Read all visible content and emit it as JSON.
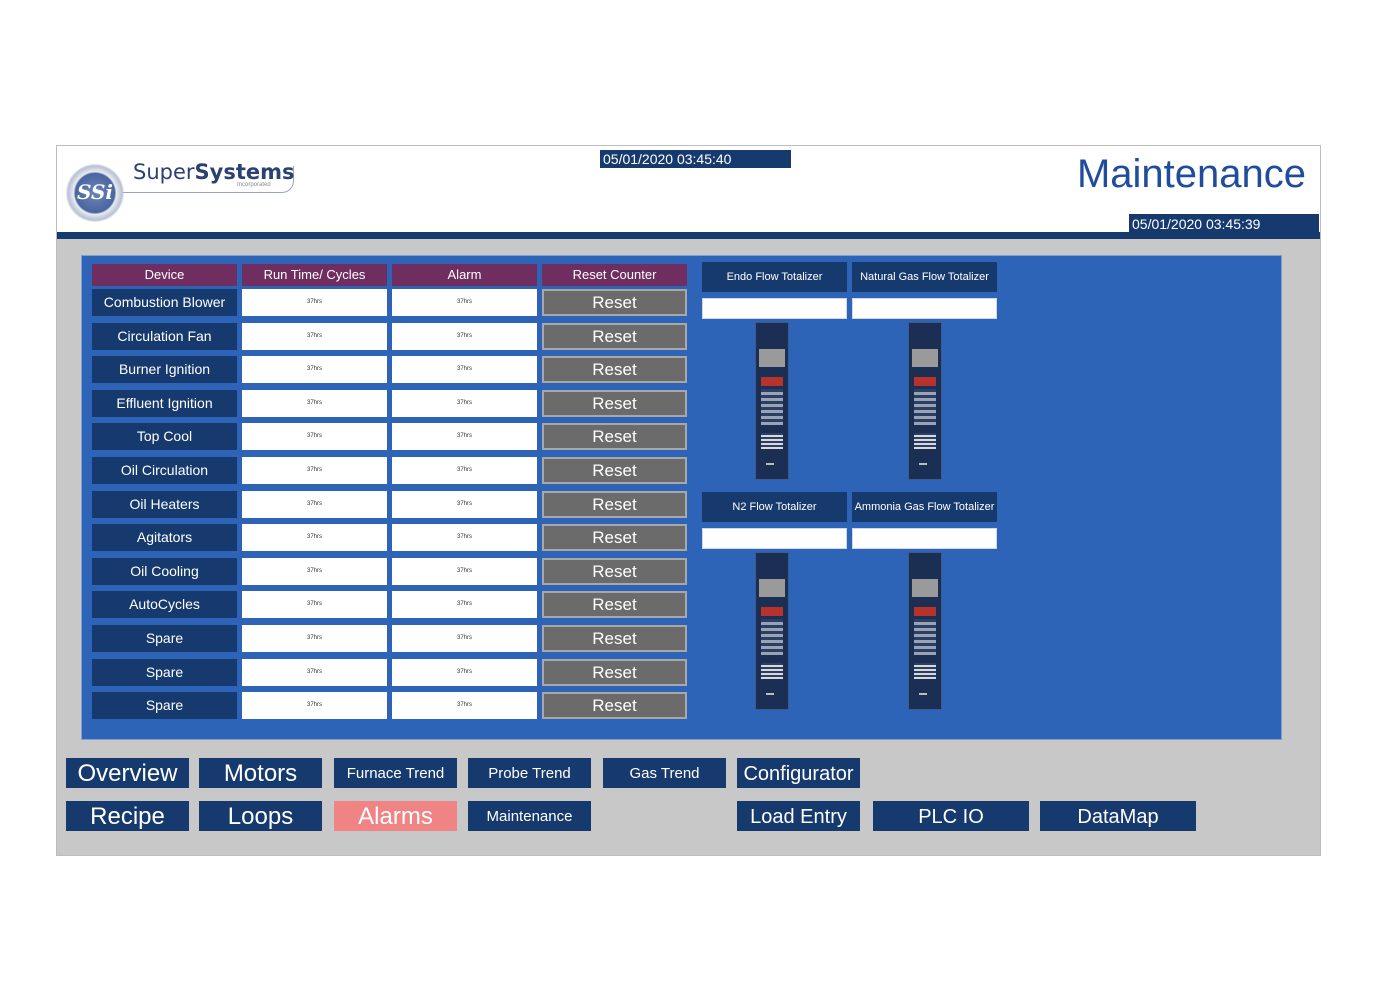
{
  "header": {
    "brand_prefix": "Super",
    "brand_bold": "Systems",
    "brand_sub": "Incorporated",
    "logo_text": "SSi",
    "datetime_top": "05/01/2020 03:45:40",
    "datetime_right": "05/01/2020 03:45:39",
    "page_title": "Maintenance"
  },
  "table": {
    "columns": [
      "Device",
      "Run Time/ Cycles",
      "Alarm",
      "Reset Counter"
    ],
    "rows": [
      {
        "device": "Combustion Blower",
        "run_time": "37hrs",
        "alarm": "37hrs",
        "reset": "Reset"
      },
      {
        "device": "Circulation Fan",
        "run_time": "37hrs",
        "alarm": "37hrs",
        "reset": "Reset"
      },
      {
        "device": "Burner Ignition",
        "run_time": "37hrs",
        "alarm": "37hrs",
        "reset": "Reset"
      },
      {
        "device": "Effluent Ignition",
        "run_time": "37hrs",
        "alarm": "37hrs",
        "reset": "Reset"
      },
      {
        "device": "Top Cool",
        "run_time": "37hrs",
        "alarm": "37hrs",
        "reset": "Reset"
      },
      {
        "device": "Oil Circulation",
        "run_time": "37hrs",
        "alarm": "37hrs",
        "reset": "Reset"
      },
      {
        "device": "Oil Heaters",
        "run_time": "37hrs",
        "alarm": "37hrs",
        "reset": "Reset"
      },
      {
        "device": "Agitators",
        "run_time": "37hrs",
        "alarm": "37hrs",
        "reset": "Reset"
      },
      {
        "device": "Oil Cooling",
        "run_time": "37hrs",
        "alarm": "37hrs",
        "reset": "Reset"
      },
      {
        "device": "AutoCycles",
        "run_time": "37hrs",
        "alarm": "37hrs",
        "reset": "Reset"
      },
      {
        "device": "Spare",
        "run_time": "37hrs",
        "alarm": "37hrs",
        "reset": "Reset"
      },
      {
        "device": "Spare",
        "run_time": "37hrs",
        "alarm": "37hrs",
        "reset": "Reset"
      },
      {
        "device": "Spare",
        "run_time": "37hrs",
        "alarm": "37hrs",
        "reset": "Reset"
      }
    ]
  },
  "totalizers": [
    {
      "label": "Endo Flow Totalizer",
      "value": ""
    },
    {
      "label": "Natural Gas Flow Totalizer",
      "value": ""
    },
    {
      "label": "N2 Flow Totalizer",
      "value": ""
    },
    {
      "label": "Ammonia Gas Flow Totalizer",
      "value": ""
    }
  ],
  "nav": {
    "overview": "Overview",
    "motors": "Motors",
    "furnace_trend": "Furnace Trend",
    "probe_trend": "Probe Trend",
    "gas_trend": "Gas Trend",
    "configurator": "Configurator",
    "recipe": "Recipe",
    "loops": "Loops",
    "alarms": "Alarms",
    "maintenance": "Maintenance",
    "load_entry": "Load Entry",
    "plc_io": "PLC IO",
    "datamap": "DataMap"
  },
  "colors": {
    "navy": "#173a6e",
    "panel_blue": "#2e64b7",
    "header_purple": "#6f2e5f",
    "reset_gray": "#6b6b6b",
    "active_pink": "#f08484"
  }
}
